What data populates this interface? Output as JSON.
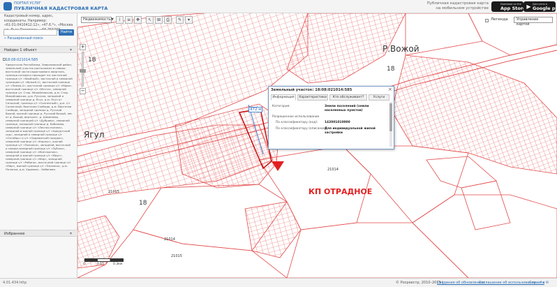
{
  "header": {
    "logo_line1": "ПОРТАЛ УСЛУГ",
    "logo_line2": "ПУБЛИЧНАЯ КАДАСТРОВАЯ КАРТА",
    "promo_line1": "Публичная кадастровая карта",
    "promo_line2": "на мобильном устройстве",
    "appstore_small": "Download on the",
    "appstore_big": "App Store",
    "googleplay_small": "Доступно в",
    "googleplay_big": "Google play"
  },
  "sidebar": {
    "search_hint": "Кадастровый номер, адрес, координаты. Например: «61:01:0410412:12», «47.6.*», «Москва ул. Льва Толстого», «55.755768, 37.617671»",
    "search_value": "",
    "search_button": "Найти",
    "advanced_search": "» Расширенный поиск",
    "results_label": "Найден 1 объект",
    "result_id": "18:08:021014:585",
    "result_description": "Удмуртская Республика, Завьяловский район, земельный участок расположен в северо-восточной части кадастрового квартала, граница которого проходит по: восточной границе с/т «Хвойный», восточной и северной границам с/т «Вожой-2», восточной границе с/т «Лемпа-2», восточной границе с/т «Мари», восточной границе с/т «Мечта», северной границе ул. Стар. Михайловская, д.м. Стар. Михайловская, д.м. Русская, западной и северной границе д. Ягул, д.м. Ягул от Сельский, граница с/т «Солнечный», д.м. с/т Солнечный, Вертячая Слобода, д.м. Вертячая Слобода, западной границе д. Русский Вожой, южной границе д. Русский Вожой, лес от д. Вожой, вертолет. д. Шеменево, северной границей с/т «Дубрава», северной границе, западной границе д. Кабаново, северной границе с/т «Лесная поляна», западной и южной границе с/т «Удмуртский сад», западной и северной границе с/т «Октябрь» и с/т «Ордеамский городок», северной границе с/т «Корпус», южной границе с/т «Полянка», западной, восточной и северо-западной границе с/т «Зубчак», северной границе с/т «Монтажник», западной и южной границе с/т «Мирт», северной границе с/т «Мир», западной границе с/т «Рябина», восточной границе с/т «Мир», южной границе с/т «Полянка», д.м. Полянка, д.м. Урдмахи – Кабанове.",
    "favorites_label": "Избранное"
  },
  "toolbar": {
    "layer_select": "Недвижимость",
    "legend_label": "Легенда",
    "basemap_select": "Управление картой"
  },
  "map": {
    "labels": {
      "rvozhoy": "Р.Вожой",
      "yagul": "Ягул",
      "zone_18": "18",
      "code_21014": "21014",
      "code_21015": "21015",
      "otradnoe": "КП ОТРАДНОЕ"
    },
    "distance": "472 м",
    "scale": {
      "s0": "0",
      "s1": "0.15",
      "s2": "0.3км"
    }
  },
  "popup": {
    "title": "Земельный участок: 18:08:021014:585",
    "close": "×",
    "tabs": [
      "Информация",
      "Характеристики",
      "Кто обслуживает?",
      "Услуги"
    ],
    "category_label": "Категория:",
    "category_value": "Земли поселений (земли населенных пунктов)",
    "permitted_use_label": "Разрешенное использование",
    "classifier_code_label": "По классификатору (код):",
    "classifier_code_value": "142001010000",
    "classifier_desc_label": "По классификатору (описание):",
    "classifier_desc_value": "Для индивидуальной жилой застройки"
  },
  "footer": {
    "build": "4.01.434.http",
    "copyright": "© Росреестр, 2010–2015 |",
    "news": "Сведения об обновлениях",
    "agreement": "Соглашение об использовании",
    "help": "Справка",
    "icons": "f v ✉"
  }
}
